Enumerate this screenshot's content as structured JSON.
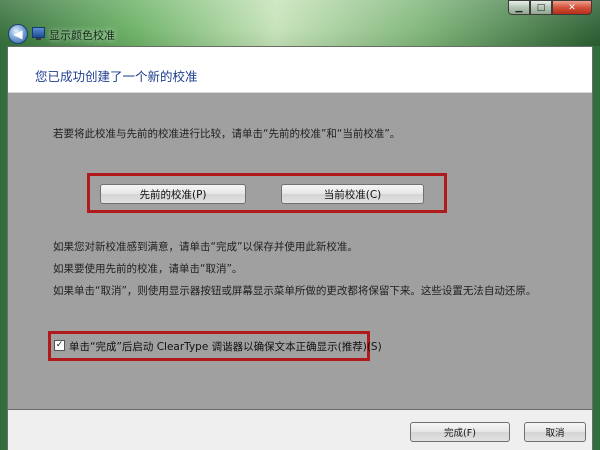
{
  "window": {
    "title": "显示颜色校准",
    "controls": {
      "minimize": "▁",
      "maximize": "□",
      "close": "✕"
    }
  },
  "page": {
    "title": "您已成功创建了一个新的校准",
    "compare_text": "若要将此校准与先前的校准进行比较，请单击“先前的校准”和“当前校准”。",
    "previous_button": "先前的校准(P)",
    "current_button": "当前校准(C)",
    "line1": "如果您对新校准感到满意，请单击“完成”以保存并使用此新校准。",
    "line2": "如果要使用先前的校准，请单击“取消”。",
    "line3": "如果单击“取消”，则使用显示器按钮或屏幕显示菜单所做的更改都将保留下来。这些设置无法自动还原。",
    "cleartype_checkbox_label": "单击“完成”后启动 ClearType 调谐器以确保文本正确显示(推荐)(S)",
    "cleartype_checked": true
  },
  "footer": {
    "finish_button": "完成(F)",
    "cancel_button": "取消"
  },
  "colors": {
    "accent_red": "#b11a1a",
    "title_blue": "#1e3f8f",
    "content_gray": "#a0a0a0"
  }
}
